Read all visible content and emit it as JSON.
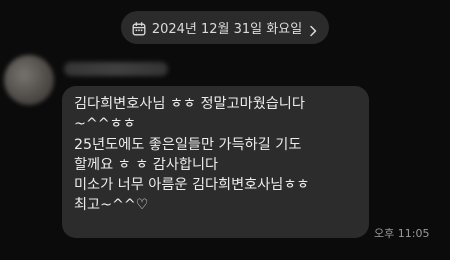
{
  "date_divider": {
    "text": "2024년 12월 31일 화요일"
  },
  "message": {
    "lines": [
      "김다희변호사님 ㅎㅎ 정말고마웠습니다",
      "~^^ㅎㅎ",
      "25년도에도 좋은일들만 가득하길 기도",
      "할께요 ㅎ ㅎ  감사합니다",
      "미소가 너무 아름운 김다희변호사님ㅎㅎ",
      "최고~^^♡"
    ],
    "time": "오후 11:05"
  }
}
